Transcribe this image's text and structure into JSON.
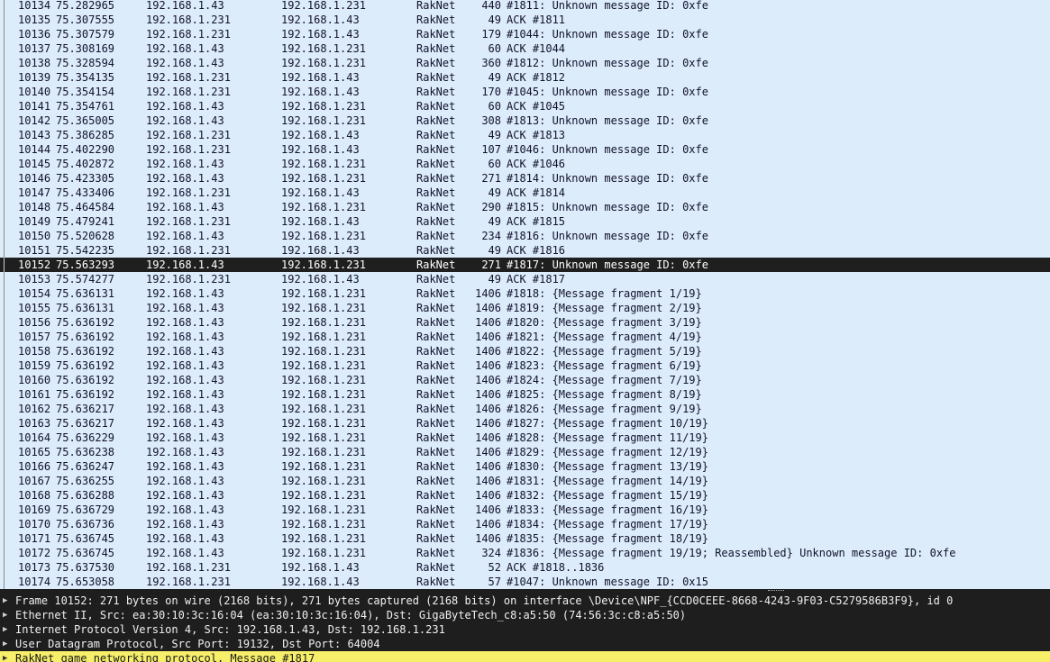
{
  "packets": [
    {
      "no": "10134",
      "time": "75.282965",
      "src": "192.168.1.43",
      "dst": "192.168.1.231",
      "proto": "RakNet",
      "len": "440",
      "info": "#1811: Unknown message ID: 0xfe"
    },
    {
      "no": "10135",
      "time": "75.307555",
      "src": "192.168.1.231",
      "dst": "192.168.1.43",
      "proto": "RakNet",
      "len": "49",
      "info": "ACK #1811"
    },
    {
      "no": "10136",
      "time": "75.307579",
      "src": "192.168.1.231",
      "dst": "192.168.1.43",
      "proto": "RakNet",
      "len": "179",
      "info": "#1044: Unknown message ID: 0xfe"
    },
    {
      "no": "10137",
      "time": "75.308169",
      "src": "192.168.1.43",
      "dst": "192.168.1.231",
      "proto": "RakNet",
      "len": "60",
      "info": "ACK #1044"
    },
    {
      "no": "10138",
      "time": "75.328594",
      "src": "192.168.1.43",
      "dst": "192.168.1.231",
      "proto": "RakNet",
      "len": "360",
      "info": "#1812: Unknown message ID: 0xfe"
    },
    {
      "no": "10139",
      "time": "75.354135",
      "src": "192.168.1.231",
      "dst": "192.168.1.43",
      "proto": "RakNet",
      "len": "49",
      "info": "ACK #1812"
    },
    {
      "no": "10140",
      "time": "75.354154",
      "src": "192.168.1.231",
      "dst": "192.168.1.43",
      "proto": "RakNet",
      "len": "170",
      "info": "#1045: Unknown message ID: 0xfe"
    },
    {
      "no": "10141",
      "time": "75.354761",
      "src": "192.168.1.43",
      "dst": "192.168.1.231",
      "proto": "RakNet",
      "len": "60",
      "info": "ACK #1045"
    },
    {
      "no": "10142",
      "time": "75.365005",
      "src": "192.168.1.43",
      "dst": "192.168.1.231",
      "proto": "RakNet",
      "len": "308",
      "info": "#1813: Unknown message ID: 0xfe"
    },
    {
      "no": "10143",
      "time": "75.386285",
      "src": "192.168.1.231",
      "dst": "192.168.1.43",
      "proto": "RakNet",
      "len": "49",
      "info": "ACK #1813"
    },
    {
      "no": "10144",
      "time": "75.402290",
      "src": "192.168.1.231",
      "dst": "192.168.1.43",
      "proto": "RakNet",
      "len": "107",
      "info": "#1046: Unknown message ID: 0xfe"
    },
    {
      "no": "10145",
      "time": "75.402872",
      "src": "192.168.1.43",
      "dst": "192.168.1.231",
      "proto": "RakNet",
      "len": "60",
      "info": "ACK #1046"
    },
    {
      "no": "10146",
      "time": "75.423305",
      "src": "192.168.1.43",
      "dst": "192.168.1.231",
      "proto": "RakNet",
      "len": "271",
      "info": "#1814: Unknown message ID: 0xfe"
    },
    {
      "no": "10147",
      "time": "75.433406",
      "src": "192.168.1.231",
      "dst": "192.168.1.43",
      "proto": "RakNet",
      "len": "49",
      "info": "ACK #1814"
    },
    {
      "no": "10148",
      "time": "75.464584",
      "src": "192.168.1.43",
      "dst": "192.168.1.231",
      "proto": "RakNet",
      "len": "290",
      "info": "#1815: Unknown message ID: 0xfe"
    },
    {
      "no": "10149",
      "time": "75.479241",
      "src": "192.168.1.231",
      "dst": "192.168.1.43",
      "proto": "RakNet",
      "len": "49",
      "info": "ACK #1815"
    },
    {
      "no": "10150",
      "time": "75.520628",
      "src": "192.168.1.43",
      "dst": "192.168.1.231",
      "proto": "RakNet",
      "len": "234",
      "info": "#1816: Unknown message ID: 0xfe"
    },
    {
      "no": "10151",
      "time": "75.542235",
      "src": "192.168.1.231",
      "dst": "192.168.1.43",
      "proto": "RakNet",
      "len": "49",
      "info": "ACK #1816"
    },
    {
      "no": "10152",
      "time": "75.563293",
      "src": "192.168.1.43",
      "dst": "192.168.1.231",
      "proto": "RakNet",
      "len": "271",
      "info": "#1817: Unknown message ID: 0xfe",
      "selected": true
    },
    {
      "no": "10153",
      "time": "75.574277",
      "src": "192.168.1.231",
      "dst": "192.168.1.43",
      "proto": "RakNet",
      "len": "49",
      "info": "ACK #1817"
    },
    {
      "no": "10154",
      "time": "75.636131",
      "src": "192.168.1.43",
      "dst": "192.168.1.231",
      "proto": "RakNet",
      "len": "1406",
      "info": "#1818: {Message fragment 1/19}"
    },
    {
      "no": "10155",
      "time": "75.636131",
      "src": "192.168.1.43",
      "dst": "192.168.1.231",
      "proto": "RakNet",
      "len": "1406",
      "info": "#1819: {Message fragment 2/19}"
    },
    {
      "no": "10156",
      "time": "75.636192",
      "src": "192.168.1.43",
      "dst": "192.168.1.231",
      "proto": "RakNet",
      "len": "1406",
      "info": "#1820: {Message fragment 3/19}"
    },
    {
      "no": "10157",
      "time": "75.636192",
      "src": "192.168.1.43",
      "dst": "192.168.1.231",
      "proto": "RakNet",
      "len": "1406",
      "info": "#1821: {Message fragment 4/19}"
    },
    {
      "no": "10158",
      "time": "75.636192",
      "src": "192.168.1.43",
      "dst": "192.168.1.231",
      "proto": "RakNet",
      "len": "1406",
      "info": "#1822: {Message fragment 5/19}"
    },
    {
      "no": "10159",
      "time": "75.636192",
      "src": "192.168.1.43",
      "dst": "192.168.1.231",
      "proto": "RakNet",
      "len": "1406",
      "info": "#1823: {Message fragment 6/19}"
    },
    {
      "no": "10160",
      "time": "75.636192",
      "src": "192.168.1.43",
      "dst": "192.168.1.231",
      "proto": "RakNet",
      "len": "1406",
      "info": "#1824: {Message fragment 7/19}"
    },
    {
      "no": "10161",
      "time": "75.636192",
      "src": "192.168.1.43",
      "dst": "192.168.1.231",
      "proto": "RakNet",
      "len": "1406",
      "info": "#1825: {Message fragment 8/19}"
    },
    {
      "no": "10162",
      "time": "75.636217",
      "src": "192.168.1.43",
      "dst": "192.168.1.231",
      "proto": "RakNet",
      "len": "1406",
      "info": "#1826: {Message fragment 9/19}"
    },
    {
      "no": "10163",
      "time": "75.636217",
      "src": "192.168.1.43",
      "dst": "192.168.1.231",
      "proto": "RakNet",
      "len": "1406",
      "info": "#1827: {Message fragment 10/19}"
    },
    {
      "no": "10164",
      "time": "75.636229",
      "src": "192.168.1.43",
      "dst": "192.168.1.231",
      "proto": "RakNet",
      "len": "1406",
      "info": "#1828: {Message fragment 11/19}"
    },
    {
      "no": "10165",
      "time": "75.636238",
      "src": "192.168.1.43",
      "dst": "192.168.1.231",
      "proto": "RakNet",
      "len": "1406",
      "info": "#1829: {Message fragment 12/19}"
    },
    {
      "no": "10166",
      "time": "75.636247",
      "src": "192.168.1.43",
      "dst": "192.168.1.231",
      "proto": "RakNet",
      "len": "1406",
      "info": "#1830: {Message fragment 13/19}"
    },
    {
      "no": "10167",
      "time": "75.636255",
      "src": "192.168.1.43",
      "dst": "192.168.1.231",
      "proto": "RakNet",
      "len": "1406",
      "info": "#1831: {Message fragment 14/19}"
    },
    {
      "no": "10168",
      "time": "75.636288",
      "src": "192.168.1.43",
      "dst": "192.168.1.231",
      "proto": "RakNet",
      "len": "1406",
      "info": "#1832: {Message fragment 15/19}"
    },
    {
      "no": "10169",
      "time": "75.636729",
      "src": "192.168.1.43",
      "dst": "192.168.1.231",
      "proto": "RakNet",
      "len": "1406",
      "info": "#1833: {Message fragment 16/19}"
    },
    {
      "no": "10170",
      "time": "75.636736",
      "src": "192.168.1.43",
      "dst": "192.168.1.231",
      "proto": "RakNet",
      "len": "1406",
      "info": "#1834: {Message fragment 17/19}"
    },
    {
      "no": "10171",
      "time": "75.636745",
      "src": "192.168.1.43",
      "dst": "192.168.1.231",
      "proto": "RakNet",
      "len": "1406",
      "info": "#1835: {Message fragment 18/19}"
    },
    {
      "no": "10172",
      "time": "75.636745",
      "src": "192.168.1.43",
      "dst": "192.168.1.231",
      "proto": "RakNet",
      "len": "324",
      "info": "#1836: {Message fragment 19/19; Reassembled} Unknown message ID: 0xfe"
    },
    {
      "no": "10173",
      "time": "75.637530",
      "src": "192.168.1.231",
      "dst": "192.168.1.43",
      "proto": "RakNet",
      "len": "52",
      "info": "ACK #1818..1836"
    },
    {
      "no": "10174",
      "time": "75.653058",
      "src": "192.168.1.231",
      "dst": "192.168.1.43",
      "proto": "RakNet",
      "len": "57",
      "info": "#1047: Unknown message ID: 0x15"
    }
  ],
  "details": [
    {
      "text": "Frame 10152: 271 bytes on wire (2168 bits), 271 bytes captured (2168 bits) on interface \\Device\\NPF_{CCD0CEEE-8668-4243-9F03-C5279586B3F9}, id 0",
      "icon": "expand-arrow-icon"
    },
    {
      "text": "Ethernet II, Src: ea:30:10:3c:16:04 (ea:30:10:3c:16:04), Dst: GigaByteTech_c8:a5:50 (74:56:3c:c8:a5:50)",
      "icon": "expand-arrow-icon"
    },
    {
      "text": "Internet Protocol Version 4, Src: 192.168.1.43, Dst: 192.168.1.231",
      "icon": "expand-arrow-icon"
    },
    {
      "text": "User Datagram Protocol, Src Port: 19132, Dst Port: 64004",
      "icon": "expand-arrow-icon"
    },
    {
      "text": "RakNet game networking protocol, Message #1817",
      "icon": "expand-arrow-icon",
      "highlighted": true
    }
  ],
  "colors": {
    "list_bg": "#dcecfa",
    "selected_bg": "#1f1f1f",
    "details_bg": "#1e1e1e",
    "highlight_bg": "#f7ef6a"
  }
}
